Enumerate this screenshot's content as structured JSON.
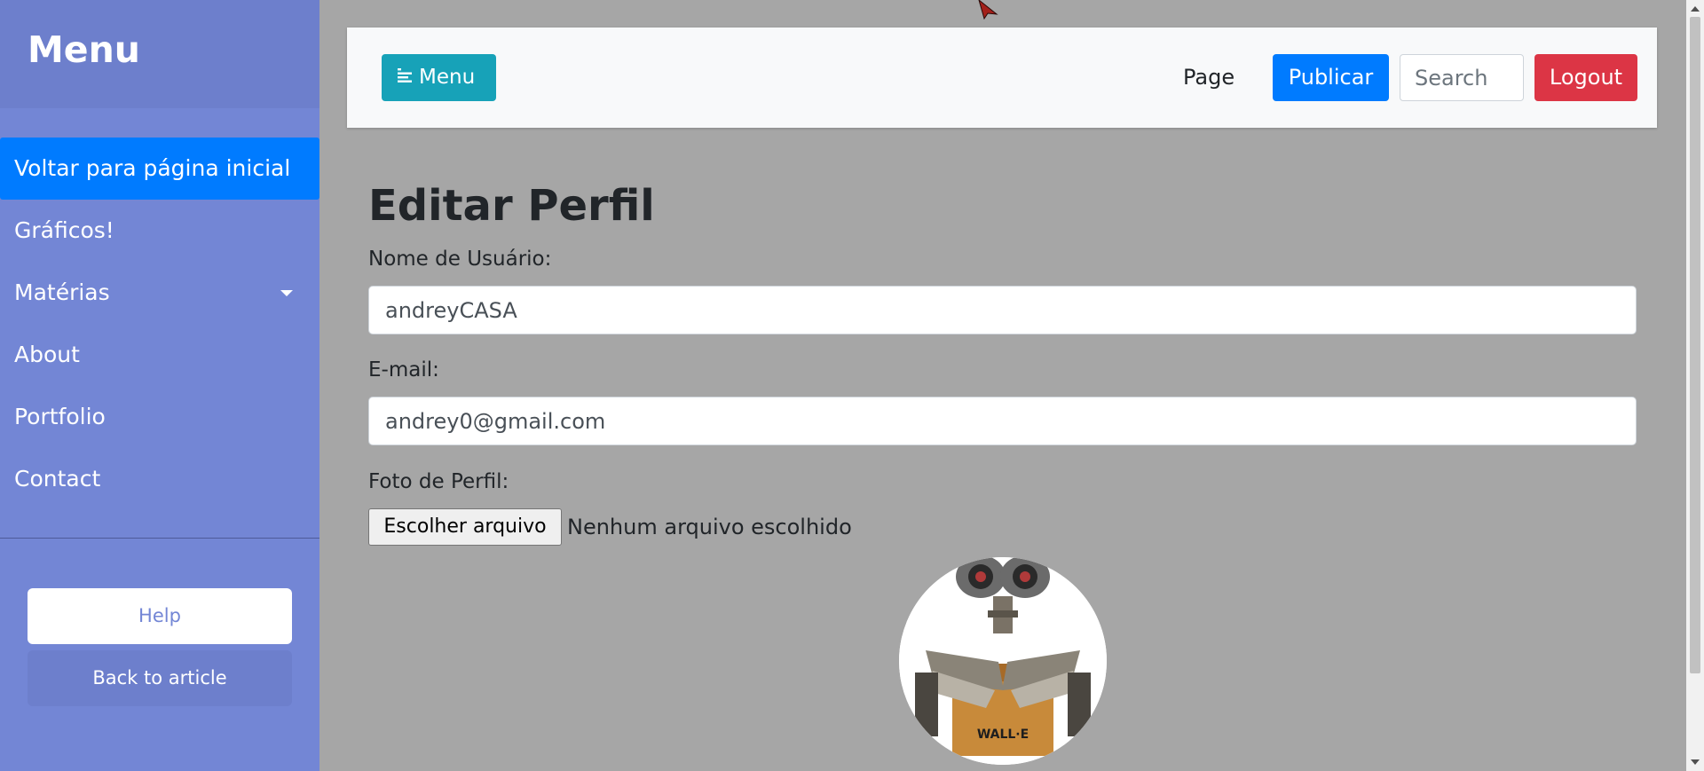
{
  "sidebar": {
    "title": "Menu",
    "items": [
      {
        "label": "Voltar para página inicial",
        "active": true
      },
      {
        "label": "Gráficos!"
      },
      {
        "label": "Matérias",
        "dropdown": true
      },
      {
        "label": "About"
      },
      {
        "label": "Portfolio"
      },
      {
        "label": "Contact"
      }
    ],
    "help_label": "Help",
    "back_label": "Back to article"
  },
  "navbar": {
    "menu_label": "Menu",
    "page_label": "Page",
    "publish_label": "Publicar",
    "search_placeholder": "Search",
    "logout_label": "Logout"
  },
  "form": {
    "title": "Editar Perfil",
    "username_label": "Nome de Usuário:",
    "username_value": "andreyCASA",
    "email_label": "E-mail:",
    "email_value": "andrey0@gmail.com",
    "photo_label": "Foto de Perfil:",
    "file_button_label": "Escolher arquivo",
    "file_status": "Nenhum arquivo escolhido",
    "avatar_text": "WALL·E"
  },
  "colors": {
    "sidebar_bg": "#7386d5",
    "primary": "#007bff",
    "info": "#17a2b8",
    "danger": "#dc3545",
    "page_bg": "#a6a6a6"
  }
}
